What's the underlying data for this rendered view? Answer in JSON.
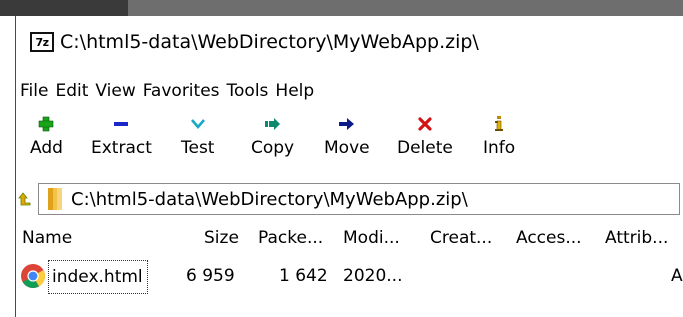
{
  "window": {
    "title": "C:\\html5-data\\WebDirectory\\MyWebApp.zip\\",
    "app_icon_text": "7z"
  },
  "menu": [
    "File",
    "Edit",
    "View",
    "Favorites",
    "Tools",
    "Help"
  ],
  "toolbar": [
    {
      "label": "Add",
      "icon": "add-icon",
      "color": "#19a319"
    },
    {
      "label": "Extract",
      "icon": "extract-icon",
      "color": "#1a27c9"
    },
    {
      "label": "Test",
      "icon": "test-icon",
      "color": "#16a9c8"
    },
    {
      "label": "Copy",
      "icon": "copy-icon",
      "color": "#0c8a6e"
    },
    {
      "label": "Move",
      "icon": "move-icon",
      "color": "#0c1a8a"
    },
    {
      "label": "Delete",
      "icon": "delete-icon",
      "color": "#d21414"
    },
    {
      "label": "Info",
      "icon": "info-icon",
      "color": "#b98b00"
    }
  ],
  "address": {
    "path": "C:\\html5-data\\WebDirectory\\MyWebApp.zip\\"
  },
  "columns": [
    "Name",
    "Size",
    "Packe...",
    "Modi...",
    "Creat...",
    "Acces...",
    "Attrib..."
  ],
  "files": [
    {
      "name": "index.html",
      "size": "6 959",
      "packed": "1 642",
      "modified": "2020...",
      "created": "",
      "accessed": "",
      "attributes": "A",
      "icon": "chrome-icon"
    }
  ]
}
